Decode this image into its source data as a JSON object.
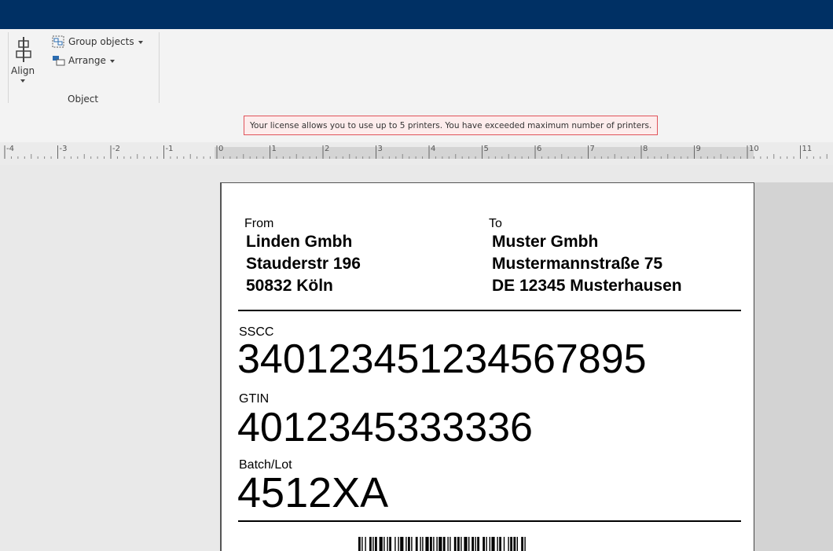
{
  "colors": {
    "topbar": "#003064",
    "ribbon": "#f3f3f3",
    "warning_border": "#e0535a",
    "warning_bg": "#fdecec"
  },
  "ribbon": {
    "align": {
      "label": "Align",
      "icon": "align-icon"
    },
    "group_objects": {
      "label": "Group objects",
      "icon": "group-objects-icon"
    },
    "arrange": {
      "label": "Arrange",
      "icon": "arrange-icon"
    },
    "group_label": "Object"
  },
  "notice": {
    "text": "Your license allows you to use up to 5 printers. You have exceeded  maximum number of printers."
  },
  "ruler": {
    "labels": [
      "-4",
      "-3",
      "-2",
      "-1",
      "0",
      "1",
      "2",
      "3",
      "4",
      "5",
      "6",
      "7",
      "8",
      "9",
      "10",
      "11"
    ]
  },
  "label": {
    "from": {
      "caption": "From",
      "lines": [
        "Linden Gmbh",
        "Stauderstr 196",
        "50832 Köln"
      ]
    },
    "to": {
      "caption": "To",
      "lines": [
        "Muster Gmbh",
        "Mustermannstraße 75",
        "DE 12345 Musterhausen"
      ]
    },
    "sscc": {
      "caption": "SSCC",
      "value": "340123451234567895"
    },
    "gtin": {
      "caption": "GTIN",
      "value": "4012345333336"
    },
    "batch": {
      "caption": "Batch/Lot",
      "value": "4512XA"
    }
  }
}
